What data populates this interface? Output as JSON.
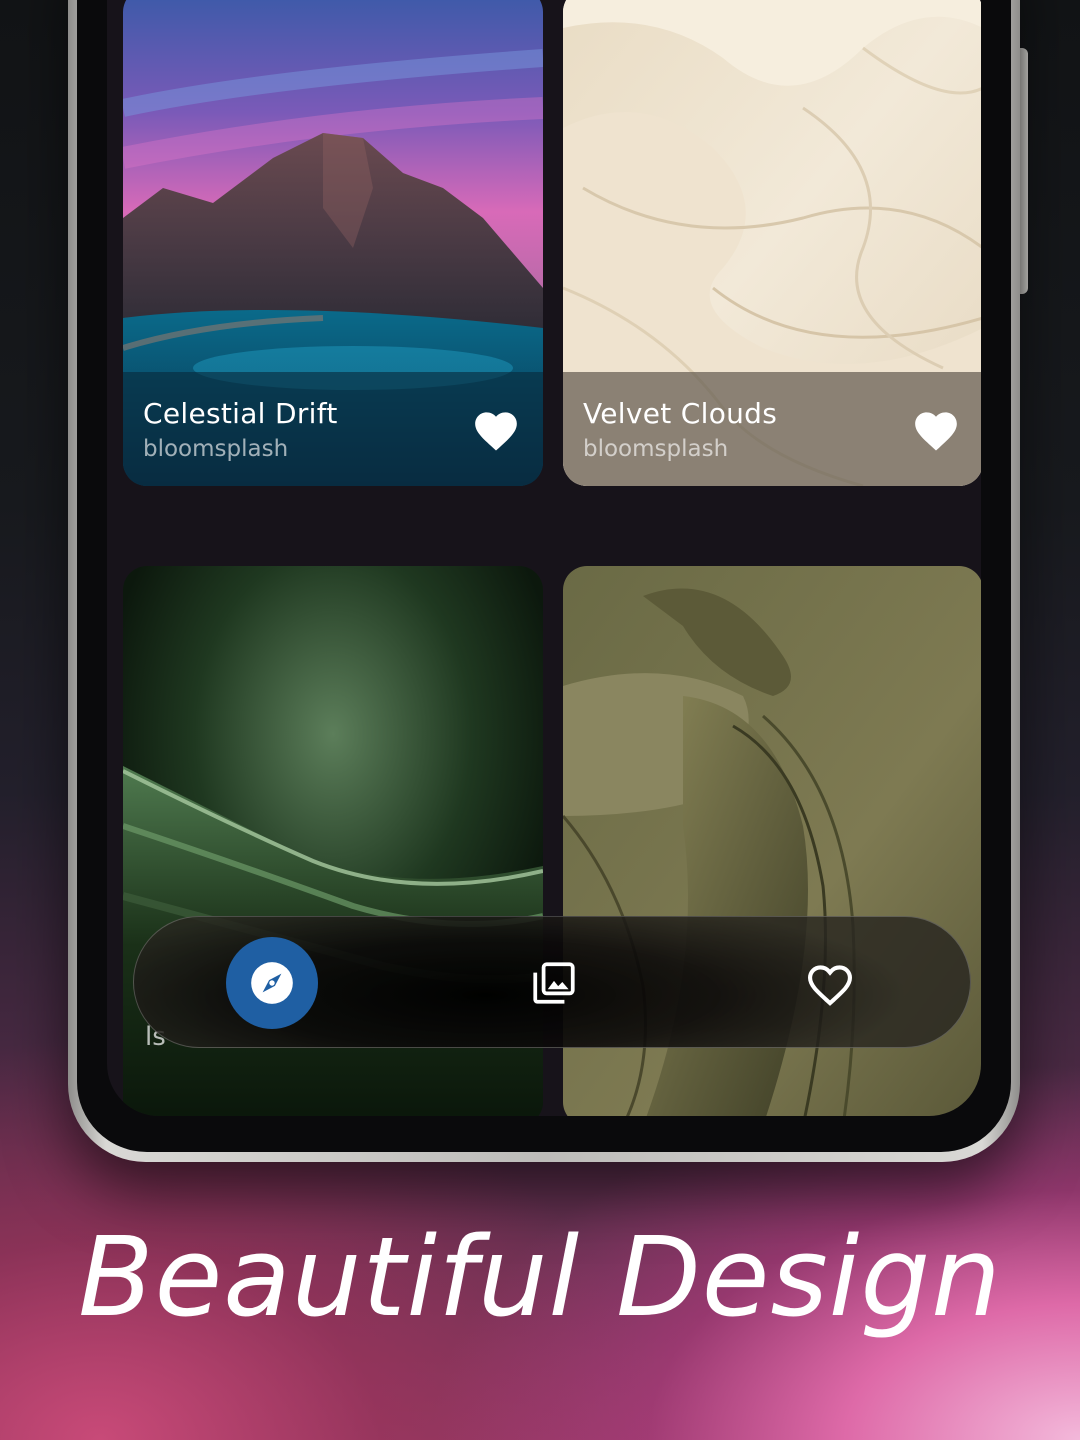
{
  "headline": "Beautiful Design",
  "wallpapers": [
    {
      "title": "Celestial Drift",
      "author": "bloomsplash",
      "favorite": true
    },
    {
      "title": "Velvet Clouds",
      "author": "bloomsplash",
      "favorite": true
    },
    {
      "title": "",
      "author": "",
      "partial_label": "ls"
    },
    {
      "title": "",
      "author": ""
    }
  ],
  "bottom_nav": {
    "items": [
      {
        "icon": "compass-icon",
        "active": true
      },
      {
        "icon": "collections-icon",
        "active": false
      },
      {
        "icon": "heart-outline-icon",
        "active": false
      }
    ]
  },
  "colors": {
    "nav_active": "#1f5fa3",
    "screen_bg": "#17131a",
    "accent_pink": "#de6aa8"
  }
}
